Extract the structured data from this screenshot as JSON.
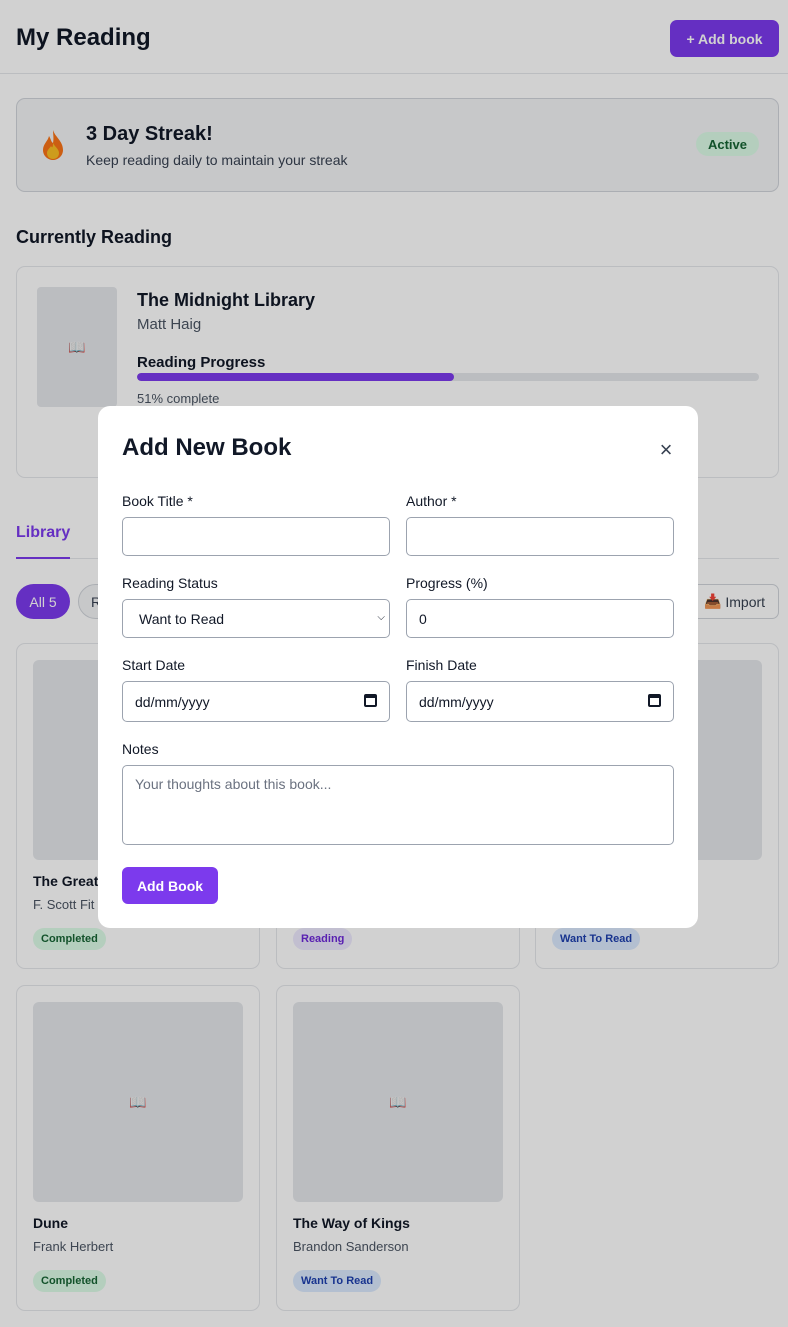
{
  "header": {
    "title": "My Reading",
    "add_book_label": "+ Add book"
  },
  "streak": {
    "title": "3 Day Streak!",
    "subtitle": "Keep reading daily to maintain your streak",
    "badge": "Active",
    "icon": "fire-icon"
  },
  "current": {
    "section_title": "Currently Reading",
    "book": {
      "title": "The Midnight Library",
      "author": "Matt Haig",
      "progress_label": "Reading Progress",
      "progress": 51,
      "progress_text": "51% complete"
    }
  },
  "tabs": {
    "library": "Library"
  },
  "filters": {
    "all": "All 5",
    "reading": "R",
    "import": "Import"
  },
  "books": [
    {
      "title": "The Great",
      "author": "F. Scott Fit",
      "status": "Completed"
    },
    {
      "title": "",
      "author": "",
      "status": "Reading"
    },
    {
      "title": "",
      "author": "",
      "status": "Want To Read"
    },
    {
      "title": "Dune",
      "author": "Frank Herbert",
      "status": "Completed"
    },
    {
      "title": "The Way of Kings",
      "author": "Brandon Sanderson",
      "status": "Want To Read"
    }
  ],
  "book_icon": "📖",
  "modal": {
    "title": "Add New Book",
    "close": "×",
    "title_label": "Book Title *",
    "author_label": "Author *",
    "status_label": "Reading Status",
    "status_value": "Want to Read",
    "progress_label": "Progress (%)",
    "progress_value": "0",
    "start_label": "Start Date",
    "start_value": "dd/mm/yyyy",
    "finish_label": "Finish Date",
    "finish_value": "dd/mm/yyyy",
    "notes_label": "Notes",
    "notes_placeholder": "Your thoughts about this book...",
    "submit": "Add Book"
  },
  "colors": {
    "accent": "#7c3aed",
    "completed": "#166534",
    "reading": "#6d28d9",
    "want": "#1e40af"
  }
}
